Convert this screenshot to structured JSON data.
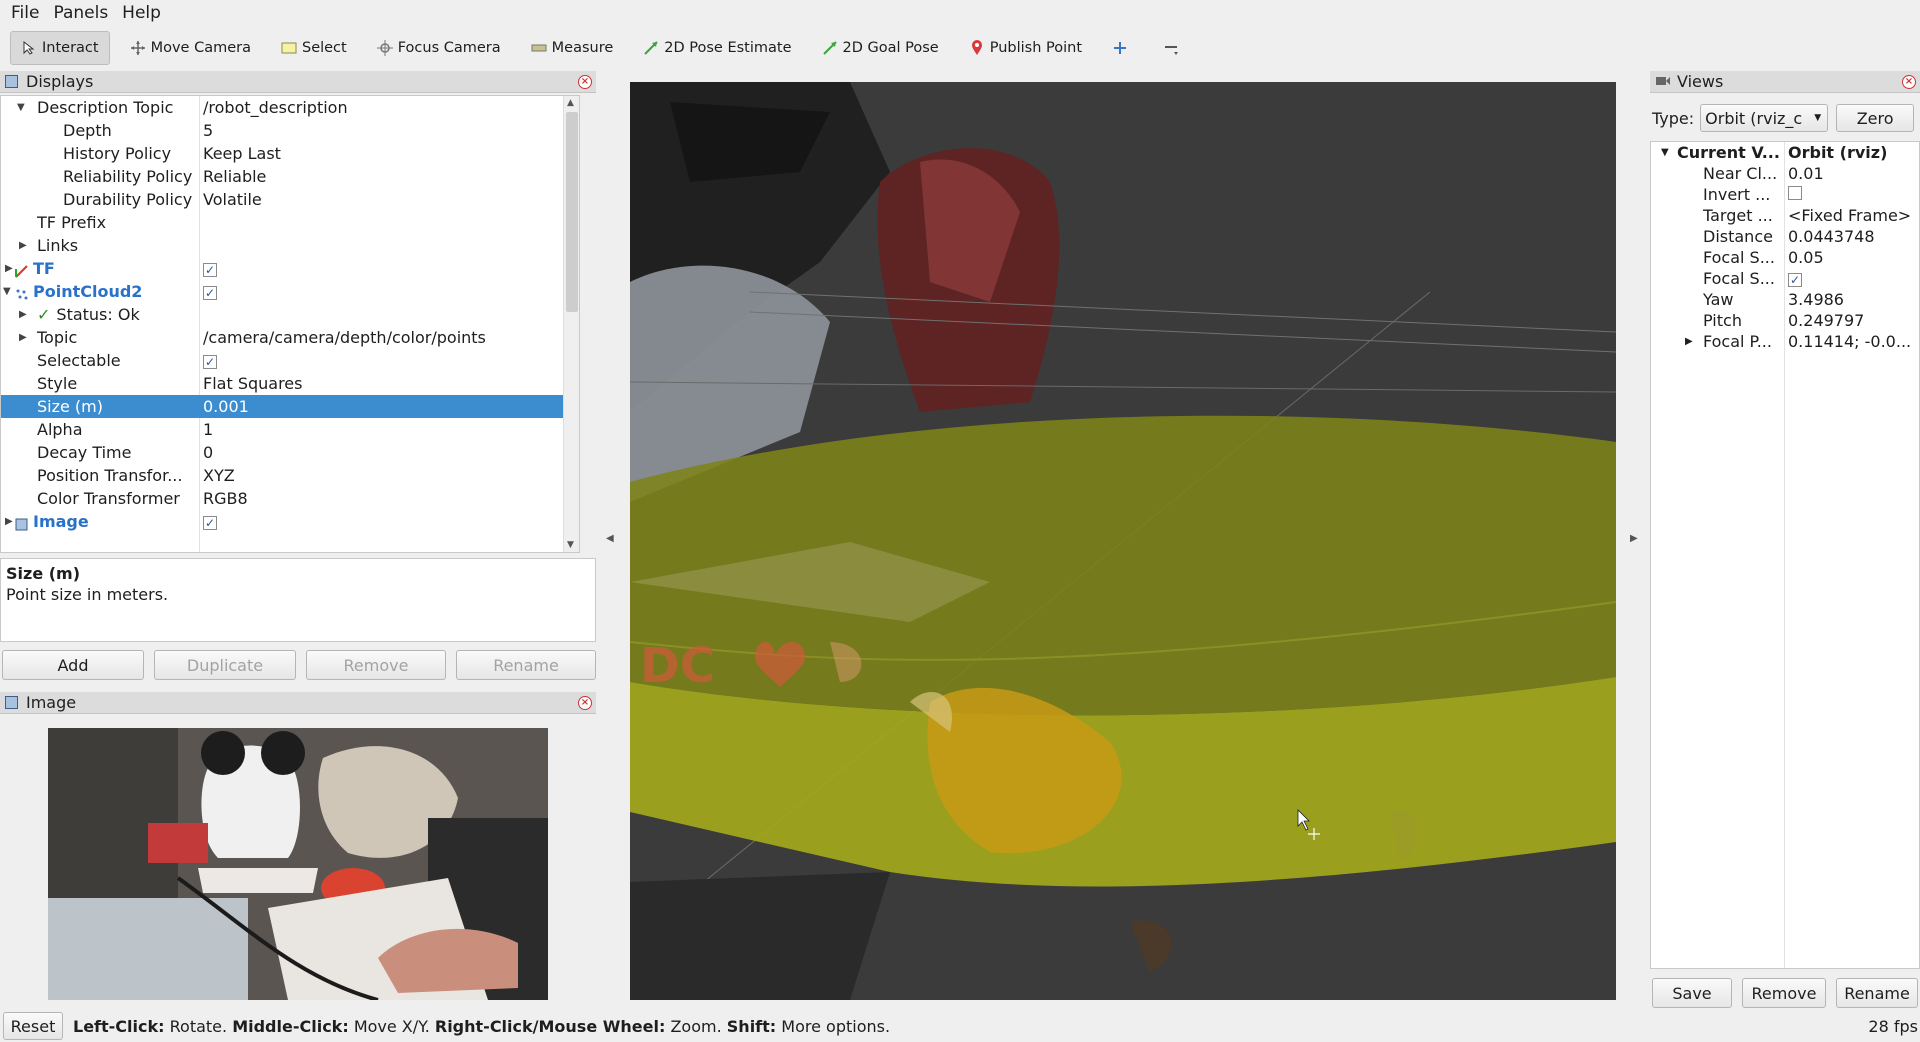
{
  "menu": [
    "File",
    "Panels",
    "Help"
  ],
  "toolbar": [
    {
      "label": "Interact",
      "icon": "cursor-icon",
      "active": true
    },
    {
      "label": "Move Camera",
      "icon": "move-camera-icon"
    },
    {
      "label": "Select",
      "icon": "select-icon"
    },
    {
      "label": "Focus Camera",
      "icon": "focus-camera-icon"
    },
    {
      "label": "Measure",
      "icon": "measure-icon"
    },
    {
      "label": "2D Pose Estimate",
      "icon": "pose-estimate-icon"
    },
    {
      "label": "2D Goal Pose",
      "icon": "goal-pose-icon"
    },
    {
      "label": "Publish Point",
      "icon": "publish-point-icon"
    }
  ],
  "displays": {
    "title": "Displays",
    "rows": [
      {
        "name": "Description Topic",
        "value": "/robot_description"
      },
      {
        "name": "Depth",
        "value": "5"
      },
      {
        "name": "History Policy",
        "value": "Keep Last"
      },
      {
        "name": "Reliability Policy",
        "value": "Reliable"
      },
      {
        "name": "Durability Policy",
        "value": "Volatile"
      },
      {
        "name": "TF Prefix",
        "value": ""
      },
      {
        "name": "Links",
        "value": ""
      },
      {
        "name": "TF",
        "value": ""
      },
      {
        "name": "PointCloud2",
        "value": ""
      },
      {
        "name": "Status: Ok",
        "value": ""
      },
      {
        "name": "Topic",
        "value": "/camera/camera/depth/color/points"
      },
      {
        "name": "Selectable",
        "value": ""
      },
      {
        "name": "Style",
        "value": "Flat Squares"
      },
      {
        "name": "Size (m)",
        "value": "0.001"
      },
      {
        "name": "Alpha",
        "value": "1"
      },
      {
        "name": "Decay Time",
        "value": "0"
      },
      {
        "name": "Position Transfor...",
        "value": "XYZ"
      },
      {
        "name": "Color Transformer",
        "value": "RGB8"
      },
      {
        "name": "Image",
        "value": ""
      }
    ],
    "description_title": "Size (m)",
    "description_text": "Point size in meters.",
    "buttons": {
      "add": "Add",
      "duplicate": "Duplicate",
      "remove": "Remove",
      "rename": "Rename"
    }
  },
  "image_panel": {
    "title": "Image"
  },
  "views": {
    "title": "Views",
    "type_label": "Type:",
    "type_value": "Orbit (rviz_c",
    "zero": "Zero",
    "rows": [
      {
        "name": "Current V...",
        "value": "Orbit (rviz)"
      },
      {
        "name": "Near Cl...",
        "value": "0.01"
      },
      {
        "name": "Invert ...",
        "value": ""
      },
      {
        "name": "Target ...",
        "value": "<Fixed Frame>"
      },
      {
        "name": "Distance",
        "value": "0.0443748"
      },
      {
        "name": "Focal S...",
        "value": "0.05"
      },
      {
        "name": "Focal S...",
        "value": ""
      },
      {
        "name": "Yaw",
        "value": "3.4986"
      },
      {
        "name": "Pitch",
        "value": "0.249797"
      },
      {
        "name": "Focal P...",
        "value": "0.11414; -0.0..."
      }
    ],
    "buttons": {
      "save": "Save",
      "remove": "Remove",
      "rename": "Rename"
    }
  },
  "status": {
    "reset": "Reset",
    "k1": "Left-Click:",
    "v1": "Rotate.",
    "k2": "Middle-Click:",
    "v2": "Move X/Y.",
    "k3": "Right-Click/Mouse Wheel:",
    "v3": "Zoom.",
    "k4": "Shift:",
    "v4": "More options.",
    "fps": "28 fps"
  },
  "viewport_text": "DC"
}
